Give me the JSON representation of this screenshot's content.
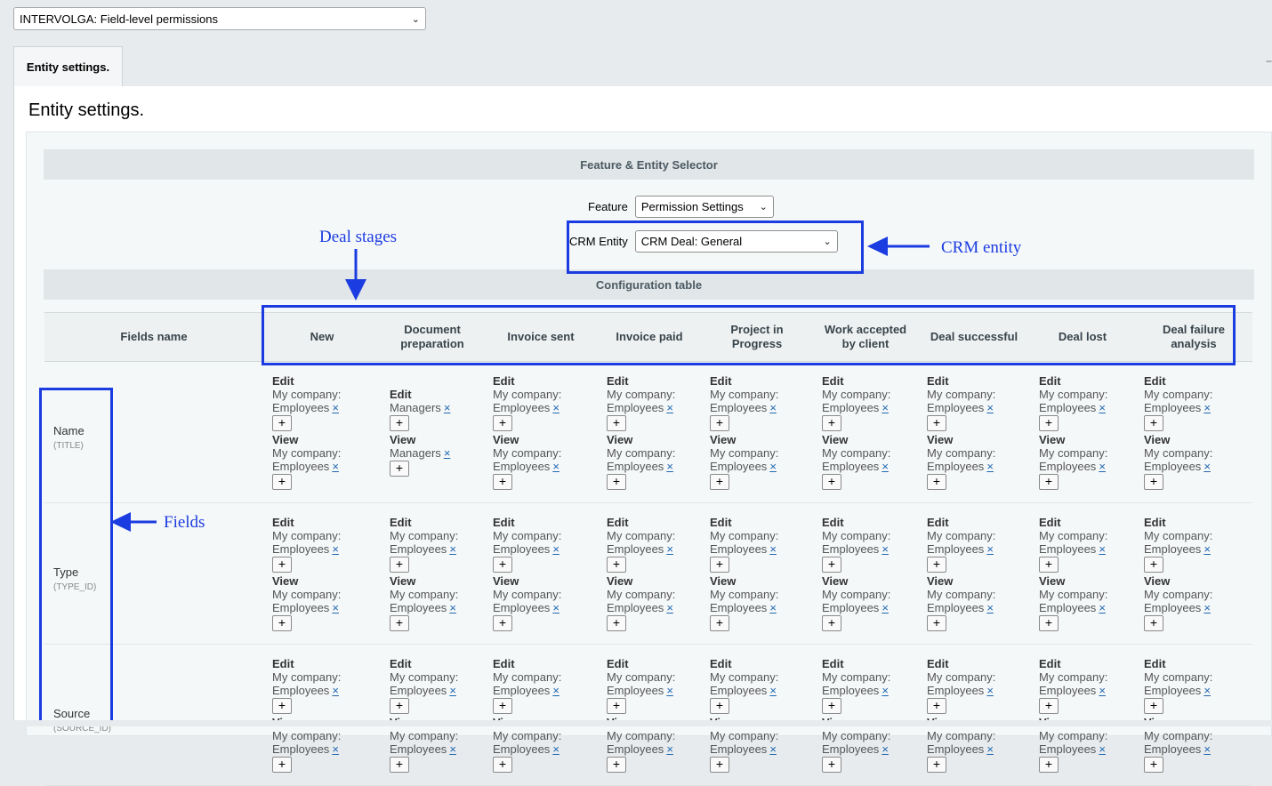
{
  "module_select": {
    "value": "INTERVOLGA: Field-level permissions"
  },
  "tabs": [
    {
      "label": "Entity settings."
    }
  ],
  "tab_strip_right_icon": "collapse-icon",
  "page_title": "Entity settings.",
  "selector": {
    "section_title": "Feature & Entity Selector",
    "feature_label": "Feature",
    "feature_value": "Permission Settings",
    "entity_label": "CRM Entity",
    "entity_value": "CRM Deal: General"
  },
  "config": {
    "section_title": "Configuration table",
    "fields_header": "Fields name",
    "stages": [
      "New",
      "Document preparation",
      "Invoice sent",
      "Invoice paid",
      "Project in Progress",
      "Work accepted by client",
      "Deal successful",
      "Deal lost",
      "Deal failure analysis"
    ],
    "rows": [
      {
        "name": "Name",
        "code": "(TITLE)",
        "cells": [
          {
            "edit": [
              "My company:",
              "Employees"
            ],
            "view": [
              "My company:",
              "Employees"
            ]
          },
          {
            "edit": [
              "Managers"
            ],
            "view": [
              "Managers"
            ]
          },
          {
            "edit": [
              "My company:",
              "Employees"
            ],
            "view": [
              "My company:",
              "Employees"
            ]
          },
          {
            "edit": [
              "My company:",
              "Employees"
            ],
            "view": [
              "My company:",
              "Employees"
            ]
          },
          {
            "edit": [
              "My company:",
              "Employees"
            ],
            "view": [
              "My company:",
              "Employees"
            ]
          },
          {
            "edit": [
              "My company:",
              "Employees"
            ],
            "view": [
              "My company:",
              "Employees"
            ]
          },
          {
            "edit": [
              "My company:",
              "Employees"
            ],
            "view": [
              "My company:",
              "Employees"
            ]
          },
          {
            "edit": [
              "My company:",
              "Employees"
            ],
            "view": [
              "My company:",
              "Employees"
            ]
          },
          {
            "edit": [
              "My company:",
              "Employees"
            ],
            "view": [
              "My company:",
              "Employees"
            ]
          }
        ]
      },
      {
        "name": "Type",
        "code": "(TYPE_ID)",
        "cells": [
          {
            "edit": [
              "My company:",
              "Employees"
            ],
            "view": [
              "My company:",
              "Employees"
            ]
          },
          {
            "edit": [
              "My company:",
              "Employees"
            ],
            "view": [
              "My company:",
              "Employees"
            ]
          },
          {
            "edit": [
              "My company:",
              "Employees"
            ],
            "view": [
              "My company:",
              "Employees"
            ]
          },
          {
            "edit": [
              "My company:",
              "Employees"
            ],
            "view": [
              "My company:",
              "Employees"
            ]
          },
          {
            "edit": [
              "My company:",
              "Employees"
            ],
            "view": [
              "My company:",
              "Employees"
            ]
          },
          {
            "edit": [
              "My company:",
              "Employees"
            ],
            "view": [
              "My company:",
              "Employees"
            ]
          },
          {
            "edit": [
              "My company:",
              "Employees"
            ],
            "view": [
              "My company:",
              "Employees"
            ]
          },
          {
            "edit": [
              "My company:",
              "Employees"
            ],
            "view": [
              "My company:",
              "Employees"
            ]
          },
          {
            "edit": [
              "My company:",
              "Employees"
            ],
            "view": [
              "My company:",
              "Employees"
            ]
          }
        ]
      },
      {
        "name": "Source",
        "code": "(SOURCE_ID)",
        "cells": [
          {
            "edit": [
              "My company:",
              "Employees"
            ],
            "view": [
              "My company:",
              "Employees"
            ]
          },
          {
            "edit": [
              "My company:",
              "Employees"
            ],
            "view": [
              "My company:",
              "Employees"
            ]
          },
          {
            "edit": [
              "My company:",
              "Employees"
            ],
            "view": [
              "My company:",
              "Employees"
            ]
          },
          {
            "edit": [
              "My company:",
              "Employees"
            ],
            "view": [
              "My company:",
              "Employees"
            ]
          },
          {
            "edit": [
              "My company:",
              "Employees"
            ],
            "view": [
              "My company:",
              "Employees"
            ]
          },
          {
            "edit": [
              "My company:",
              "Employees"
            ],
            "view": [
              "My company:",
              "Employees"
            ]
          },
          {
            "edit": [
              "My company:",
              "Employees"
            ],
            "view": [
              "My company:",
              "Employees"
            ]
          },
          {
            "edit": [
              "My company:",
              "Employees"
            ],
            "view": [
              "My company:",
              "Employees"
            ]
          },
          {
            "edit": [
              "My company:",
              "Employees"
            ],
            "view": [
              "My company:",
              "Employees"
            ]
          }
        ]
      }
    ],
    "edit_label": "Edit",
    "view_label": "View",
    "remove_glyph": "×",
    "add_glyph": "+"
  },
  "annotations": {
    "deal_stages": "Deal stages",
    "crm_entity": "CRM entity",
    "fields": "Fields",
    "color": "#1b3ce0"
  }
}
